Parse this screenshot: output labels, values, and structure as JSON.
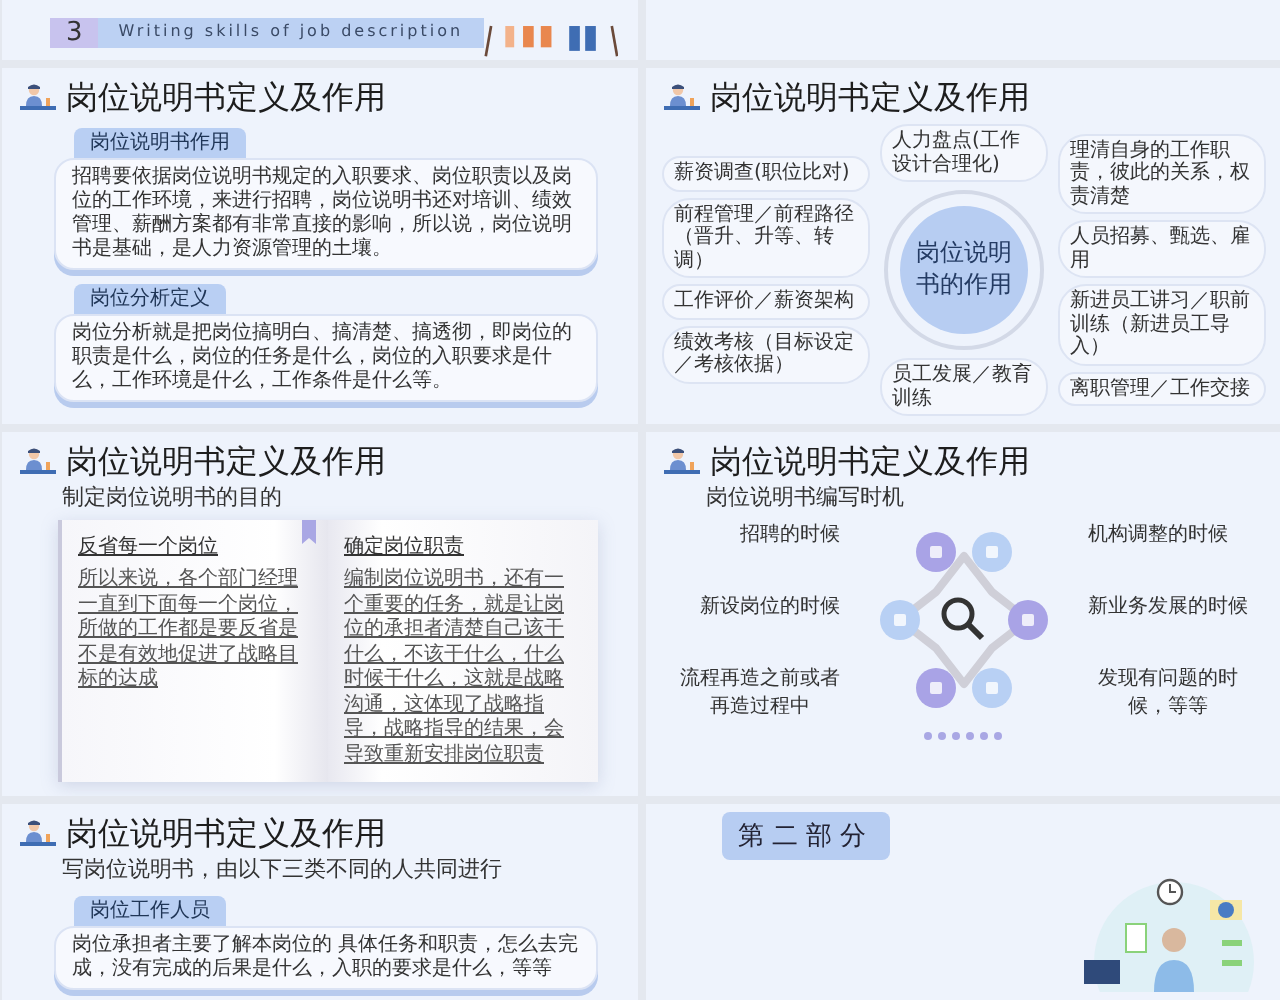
{
  "slides": [
    {
      "kind": "section_banner",
      "number": "3",
      "subtitle": "Writing skills of job description"
    },
    {
      "kind": "blank"
    },
    {
      "kind": "cards",
      "title": "岗位说明书定义及作用",
      "cards": [
        {
          "heading": "岗位说明书作用",
          "body": "招聘要依据岗位说明书规定的入职要求、岗位职责以及岗位的工作环境，来进行招聘，岗位说明书还对培训、绩效管理、薪酬方案都有非常直接的影响，所以说，岗位说明书是基础，是人力资源管理的土壤。"
        },
        {
          "heading": "岗位分析定义",
          "body": "岗位分析就是把岗位搞明白、搞清楚、搞透彻，即岗位的职责是什么，岗位的任务是什么，岗位的入职要求是什么，工作环境是什么，工作条件是什么等。"
        }
      ]
    },
    {
      "kind": "mindmap",
      "title": "岗位说明书定义及作用",
      "center": "岗位说明书的作用",
      "top": "人力盘点(工作设计合理化)",
      "bottom": "员工发展／教育训练",
      "left": [
        "薪资调查(职位比对)",
        "前程管理／前程路径（晋升、升等、转调）",
        "工作评价／薪资架构",
        "绩效考核（目标设定／考核依据）"
      ],
      "right": [
        "理清自身的工作职责，彼此的关系，权责清楚",
        "人员招募、甄选、雇用",
        "新进员工讲习／职前训练（新进员工导入）",
        "离职管理／工作交接"
      ]
    },
    {
      "kind": "book",
      "title": "岗位说明书定义及作用",
      "subtitle": "制定岗位说明书的目的",
      "pages": [
        {
          "heading": "反省每一个岗位",
          "body": "所以来说，各个部门经理一直到下面每一个岗位，所做的工作都是要反省是不是有效地促进了战略目标的达成"
        },
        {
          "heading": "确定岗位职责",
          "body": "编制岗位说明书，还有一个重要的任务，就是让岗位的承担者清楚自己该干什么，不该干什么，什么时候干什么，这就是战略沟通，这体现了战略指导，战略指导的结果，会导致重新安排岗位职责"
        }
      ]
    },
    {
      "kind": "timing",
      "title": "岗位说明书定义及作用",
      "subtitle": "岗位说明书编写时机",
      "left": [
        "招聘的时候",
        "新设岗位的时候",
        "流程再造之前或者再造过程中"
      ],
      "right": [
        "机构调整的时候",
        "新业务发展的时候",
        "发现有问题的时候，等等"
      ]
    },
    {
      "kind": "cards",
      "title": "岗位说明书定义及作用",
      "subtitle": "写岗位说明书，由以下三类不同的人共同进行",
      "cards": [
        {
          "heading": "岗位工作人员",
          "body": "岗位承担者主要了解本岗位的 具体任务和职责，怎么去完成，没有完成的后果是什么，入职的要求是什么，等等"
        }
      ]
    },
    {
      "kind": "section",
      "label": "第二部分"
    }
  ]
}
